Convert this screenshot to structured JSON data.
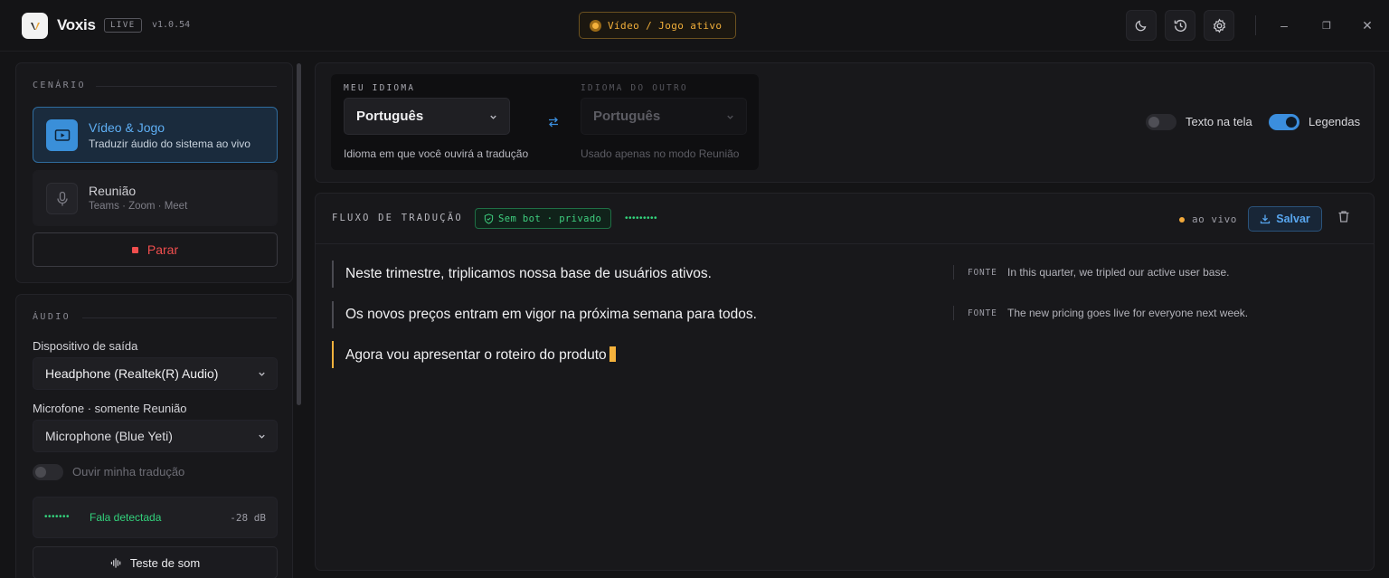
{
  "app": {
    "name": "Voxis",
    "badge": "LIVE",
    "version": "v1.0.54"
  },
  "mode_status": "Vídeo / Jogo ativo",
  "titlebar_icons": [
    "moon-icon",
    "history-icon",
    "gear-icon"
  ],
  "window_controls": {
    "minimize": "–",
    "restore": "❐",
    "close": "✕"
  },
  "sidebar": {
    "scenario": {
      "title": "CENÁRIO",
      "options": [
        {
          "title": "Vídeo & Jogo",
          "subtitle": "Traduzir áudio do sistema ao vivo",
          "active": true,
          "icon": "play-screen-icon"
        },
        {
          "title": "Reunião",
          "subtitle": "Teams · Zoom · Meet",
          "active": false,
          "icon": "microphone-icon"
        }
      ],
      "stop_label": "Parar"
    },
    "audio": {
      "title": "ÁUDIO",
      "output_label": "Dispositivo de saída",
      "output_value": "Headphone (Realtek(R) Audio)",
      "mic_label": "Microfone · somente Reunião",
      "mic_value": "Microphone (Blue Yeti)",
      "hear_translation_label": "Ouvir minha tradução",
      "hear_translation_on": false,
      "speech_dots": "•••••••",
      "speech_status": "Fala detectada",
      "level": "-28 dB",
      "sound_test_label": "Teste de som"
    }
  },
  "languages": {
    "mine": {
      "label": "MEU IDIOMA",
      "value": "Português",
      "hint": "Idioma em que você ouvirá a tradução"
    },
    "other": {
      "label": "IDIOMA DO OUTRO",
      "value": "Português",
      "hint": "Usado apenas no modo Reunião"
    },
    "options": [
      {
        "label": "Texto na tela",
        "on": false
      },
      {
        "label": "Legendas",
        "on": true
      }
    ]
  },
  "stream": {
    "title": "FLUXO DE TRADUÇÃO",
    "privacy": "Sem bot · privado",
    "dots": "•••••••••",
    "live": "ao vivo",
    "save_label": "Salvar",
    "lines": [
      {
        "text": "Neste trimestre, triplicamos nossa base de usuários ativos.",
        "source_tag": "FONTE",
        "source": "In this quarter, we tripled our active user base.",
        "state": "done"
      },
      {
        "text": "Os novos preços entram em vigor na próxima semana para todos.",
        "source_tag": "FONTE",
        "source": "The new pricing goes live for everyone next week.",
        "state": "done"
      },
      {
        "text": "Agora vou apresentar o roteiro do produto",
        "state": "typing"
      }
    ]
  },
  "colors": {
    "accent": "#3b8ede",
    "amber": "#f5b23c",
    "green": "#33d27c",
    "danger": "#f04e4e",
    "bg": "#141416"
  }
}
